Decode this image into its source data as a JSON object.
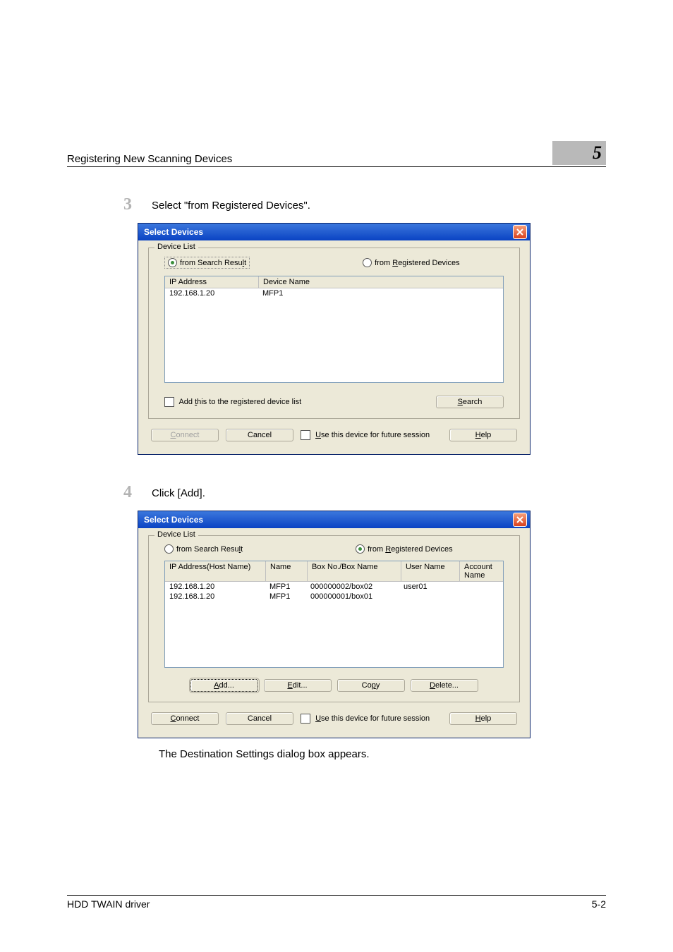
{
  "header": {
    "title": "Registering New Scanning Devices",
    "chapter": "5"
  },
  "steps": {
    "step3": {
      "num": "3",
      "text": "Select \"from Registered Devices\"."
    },
    "step4": {
      "num": "4",
      "text": "Click [Add]."
    },
    "result": "The Destination Settings dialog box appears."
  },
  "dialog1": {
    "title": "Select Devices",
    "group_legend": "Device List",
    "radio_search_prefix": "from Search Resu",
    "radio_search_ul": "l",
    "radio_search_suffix": "t",
    "radio_reg_prefix": "from ",
    "radio_reg_ul": "R",
    "radio_reg_suffix": "egistered Devices",
    "headers": {
      "ip": "IP Address",
      "name": "Device Name"
    },
    "rows": [
      {
        "ip": "192.168.1.20",
        "name": "MFP1"
      }
    ],
    "add_checkbox_prefix": "Add ",
    "add_checkbox_ul": "t",
    "add_checkbox_suffix": "his to the registered device list",
    "search_ul": "S",
    "search_suffix": "earch",
    "connect_ul": "C",
    "connect_suffix": "onnect",
    "cancel": "Cancel",
    "use_ul": "U",
    "use_suffix": "se this device for future session",
    "help_ul": "H",
    "help_suffix": "elp"
  },
  "dialog2": {
    "title": "Select Devices",
    "group_legend": "Device List",
    "radio_search_prefix": "from Search Resu",
    "radio_search_ul": "l",
    "radio_search_suffix": "t",
    "radio_reg_prefix": "from ",
    "radio_reg_ul": "R",
    "radio_reg_suffix": "egistered Devices",
    "headers": {
      "ip": "IP Address(Host Name)",
      "name": "Name",
      "box": "Box No./Box Name",
      "user": "User Name",
      "acct": "Account Name"
    },
    "rows": [
      {
        "ip": "192.168.1.20",
        "name": "MFP1",
        "box": "000000002/box02",
        "user": "user01",
        "acct": ""
      },
      {
        "ip": "192.168.1.20",
        "name": "MFP1",
        "box": "000000001/box01",
        "user": "",
        "acct": ""
      }
    ],
    "btns": {
      "add_ul": "A",
      "add_suffix": "dd...",
      "edit_ul": "E",
      "edit_suffix": "dit...",
      "copy_prefix": "Co",
      "copy_ul": "p",
      "copy_suffix": "y",
      "delete_ul": "D",
      "delete_suffix": "elete..."
    },
    "connect_ul": "C",
    "connect_suffix": "onnect",
    "cancel": "Cancel",
    "use_ul": "U",
    "use_suffix": "se this device for future session",
    "help_ul": "H",
    "help_suffix": "elp"
  },
  "footer": {
    "left": "HDD TWAIN driver",
    "right": "5-2"
  }
}
